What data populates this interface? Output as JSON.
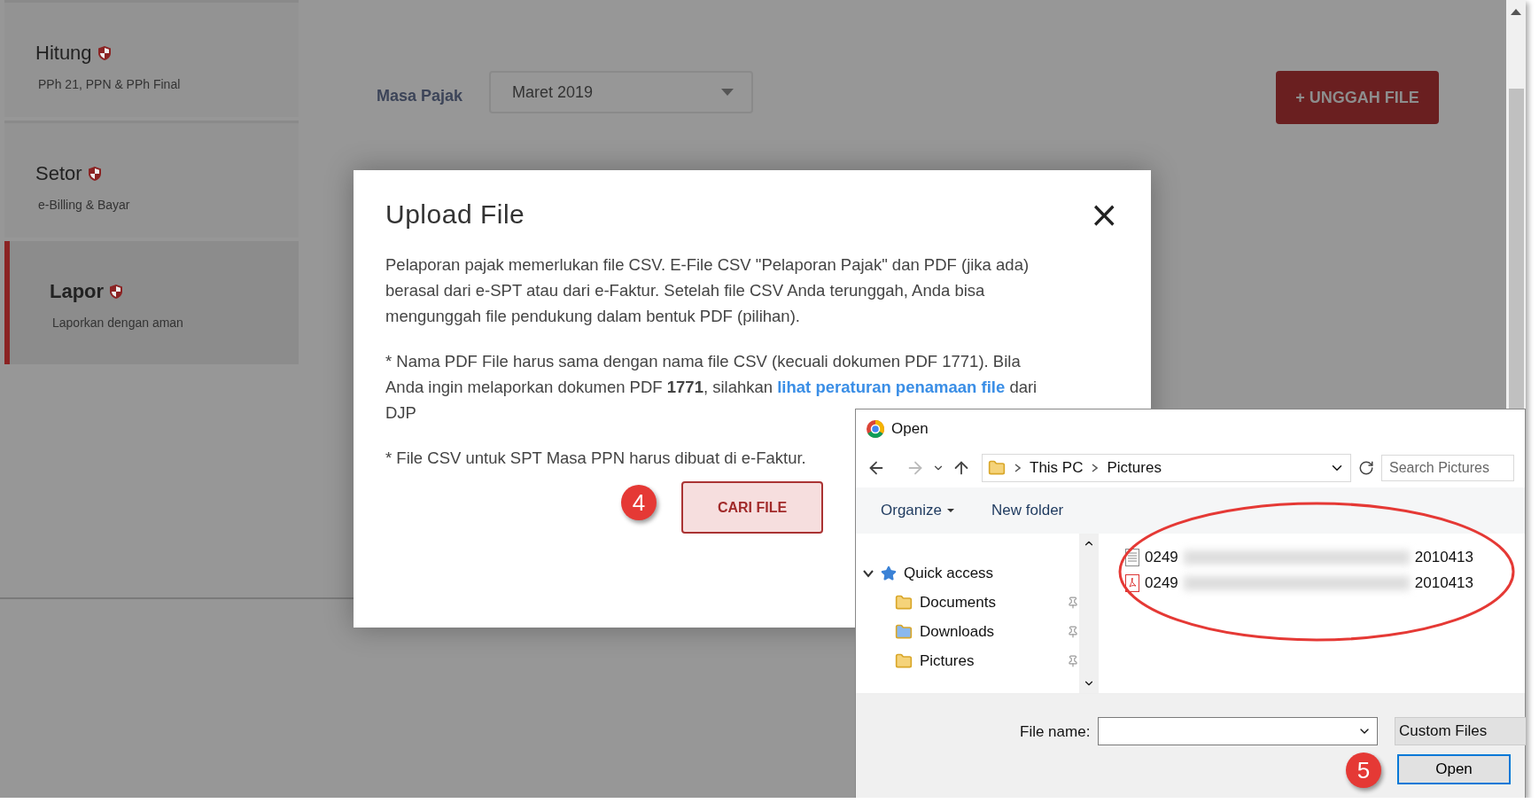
{
  "sidebar": {
    "items": [
      {
        "title": "Hitung",
        "subtitle": "PPh 21, PPN & PPh Final",
        "selected": false
      },
      {
        "title": "Setor",
        "subtitle": "e-Billing & Bayar",
        "selected": false
      },
      {
        "title": "Lapor",
        "subtitle": "Laporkan dengan aman",
        "selected": true
      }
    ]
  },
  "filter": {
    "label": "Masa Pajak",
    "value": "Maret 2019"
  },
  "upload_button": "+ UNGGAH FILE",
  "modal": {
    "title": "Upload File",
    "close": "×",
    "paragraphs": [
      {
        "text": "Pelaporan pajak memerlukan file CSV. E-File CSV \"Pelaporan Pajak\" dan PDF (jika ada) berasal dari e-SPT atau dari e-Faktur. Setelah file CSV Anda terunggah, Anda bisa mengunggah file pendukung dalam bentuk PDF (pilihan)."
      },
      {
        "text": "* Nama PDF File harus sama dengan nama file CSV (kecuali dokumen PDF 1771). Bila Anda ingin melaporkan dokumen PDF **1771**, silahkan",
        "link": "lihat peraturan penamaan file",
        "after": "dari DJP"
      },
      {
        "text": "* File CSV untuk SPT Masa PPN harus dibuat di e-Faktur."
      }
    ],
    "button": "CARI FILE",
    "step": "4"
  },
  "open_dialog": {
    "title": "Open",
    "path": [
      "This PC",
      "Pictures"
    ],
    "search": {
      "placeholder": "Search Pictures"
    },
    "toolbar": [
      "Organize",
      "New folder"
    ],
    "nav": [
      {
        "label": "Quick access",
        "expanded": true,
        "children": [
          {
            "label": "Documents",
            "kind": "documents"
          },
          {
            "label": "Downloads",
            "kind": "downloads"
          },
          {
            "label": "Pictures",
            "kind": "pictures"
          }
        ]
      }
    ],
    "files": [
      {
        "kind": "text",
        "prefix": "0249",
        "suffix": "2010413"
      },
      {
        "kind": "pdf",
        "prefix": "0249",
        "suffix": "2010413"
      }
    ],
    "file_name_label": "File name:",
    "file_type": "Custom Files",
    "open_button": "Open",
    "step": "5"
  }
}
